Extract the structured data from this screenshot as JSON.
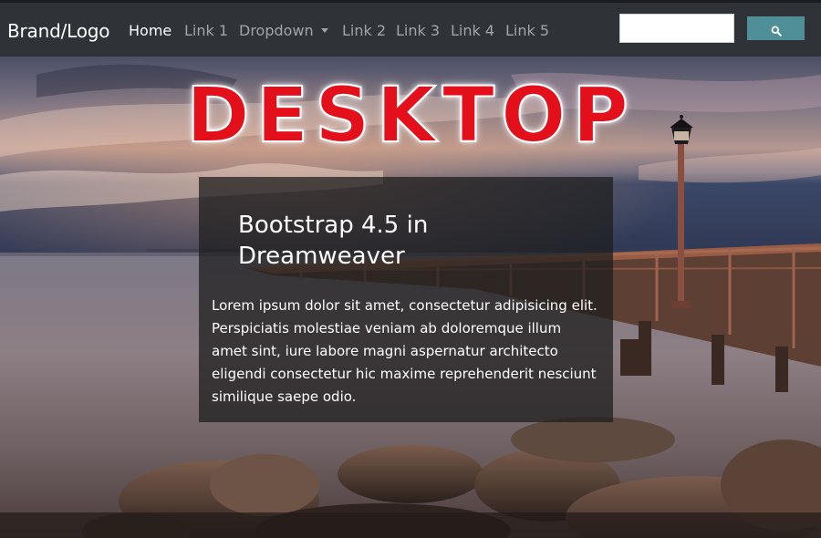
{
  "navbar": {
    "brand": "Brand/Logo",
    "links": [
      {
        "label": "Home",
        "active": true
      },
      {
        "label": "Link 1"
      },
      {
        "label": "Dropdown",
        "dropdown": true
      },
      {
        "label": "Link 2"
      },
      {
        "label": "Link 3"
      },
      {
        "label": "Link 4"
      },
      {
        "label": "Link 5"
      }
    ],
    "search": {
      "value": "",
      "button_icon": "search-icon"
    }
  },
  "hero": {
    "headline": "DESKTOP",
    "card": {
      "title": "Bootstrap 4.5 in Dreamweaver",
      "text": "Lorem ipsum dolor sit amet, consectetur adipisicing elit. Perspiciatis molestiae veniam ab doloremque illum amet sint, iure labore magni aspernatur architecto eligendi consectetur hic maxime reprehenderit nesciunt similique saepe odio."
    }
  },
  "colors": {
    "navbar_bg": "#2f3338",
    "search_button": "#4f8f98",
    "headline": "#e3101b",
    "card_bg": "rgba(30,30,30,0.74)"
  }
}
